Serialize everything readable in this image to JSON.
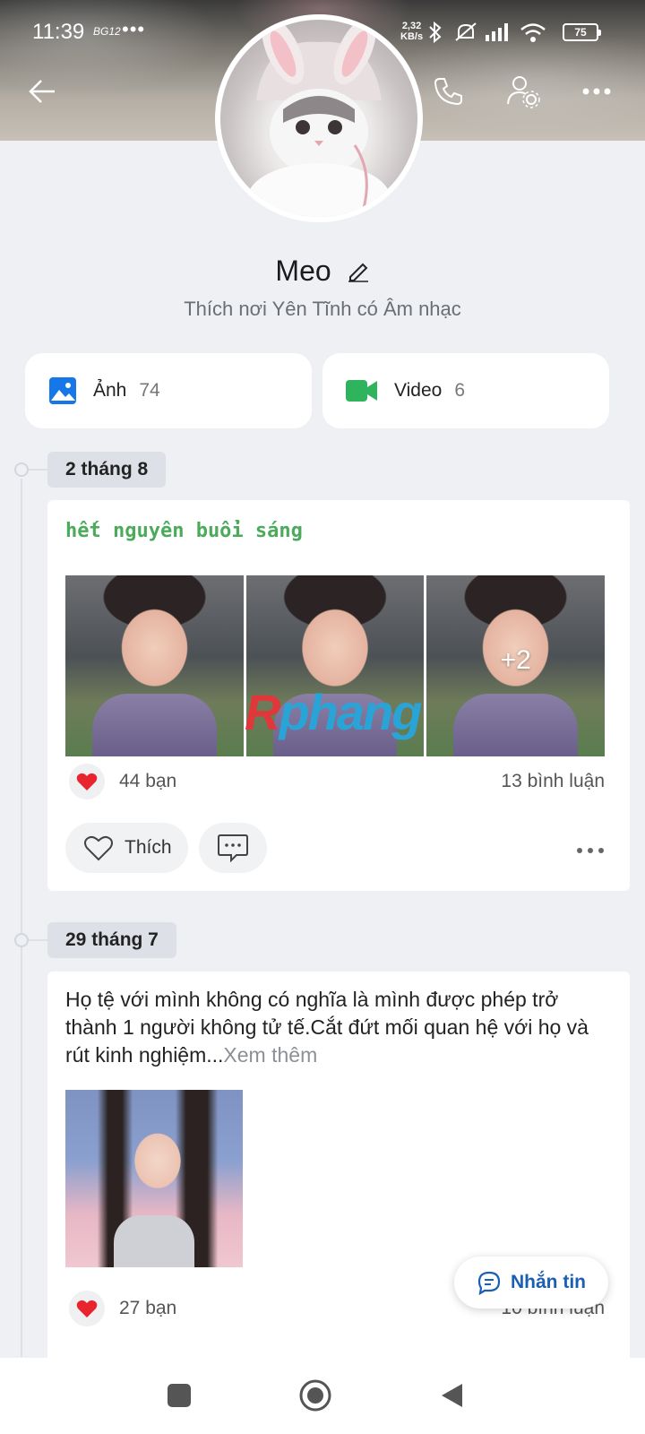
{
  "status_bar": {
    "time": "11:39",
    "carrier_label": "BG12",
    "speed_value": "2,32",
    "speed_unit": "KB/s",
    "battery": "75"
  },
  "profile": {
    "name": "Meo",
    "bio": "Thích nơi Yên Tĩnh có Âm nhạc"
  },
  "media": [
    {
      "label": "Ảnh",
      "count": "74",
      "icon": "image-icon",
      "color": "#1677e8"
    },
    {
      "label": "Video",
      "count": "6",
      "icon": "video-icon",
      "color": "#2fb35d"
    }
  ],
  "posts": [
    {
      "date": "2 tháng 8",
      "title": "hết nguyên buổi sáng",
      "more_photos": "+2",
      "watermark": {
        "part1": "R",
        "part2": "phang"
      },
      "reactions": "44 bạn",
      "comments": "13 bình luận",
      "like_label": "Thích"
    },
    {
      "date": "29 tháng 7",
      "text": "Họ tệ với mình không có nghĩa là mình được phép trở thành 1 người không tử tế.Cắt đứt mối quan hệ với họ và rút kinh nghiệm...",
      "see_more": "Xem thêm",
      "reactions": "27 bạn",
      "comments": "10 bình luận"
    }
  ],
  "fab": {
    "label": "Nhắn tin"
  },
  "colors": {
    "accent": "#1a5fb4",
    "title_green": "#4bab5b",
    "heart": "#e8242f"
  }
}
